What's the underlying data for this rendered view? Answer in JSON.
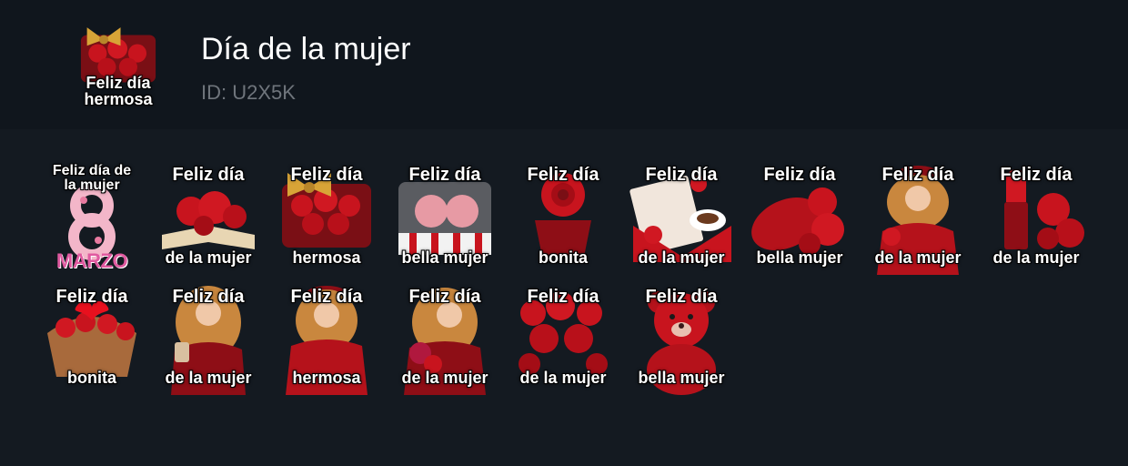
{
  "pack": {
    "title": "Día de la mujer",
    "id_label": "ID: U2X5K",
    "thumbnail": {
      "icon": "gift-strawberries-icon",
      "line1": "Feliz día",
      "line2": "hermosa"
    }
  },
  "colors": {
    "header_bg": "#10161d",
    "page_bg": "#141a21",
    "title": "#ffffff",
    "muted": "#6f757c",
    "accent_red": "#b5121b",
    "gold": "#d8a437"
  },
  "stickers": [
    {
      "icon": "number-eight-flowers-icon",
      "line1": "Feliz día de",
      "line2": "la mujer",
      "badge": "MARZO"
    },
    {
      "icon": "open-book-roses-icon",
      "line1": "Feliz día",
      "line2": "de la mujer"
    },
    {
      "icon": "gift-strawberries-icon",
      "line1": "Feliz día",
      "line2": "hermosa"
    },
    {
      "icon": "gift-box-roses-icon",
      "line1": "Feliz día",
      "line2": "bella mujer"
    },
    {
      "icon": "rose-cupcake-icon",
      "line1": "Feliz día",
      "line2": "bonita"
    },
    {
      "icon": "letter-coffee-icon",
      "line1": "Feliz día",
      "line2": "de la mujer"
    },
    {
      "icon": "beret-peonies-icon",
      "line1": "Feliz día",
      "line2": "bella mujer"
    },
    {
      "icon": "woman-red-beret-icon",
      "line1": "Feliz día",
      "line2": "de la mujer"
    },
    {
      "icon": "lipstick-roses-icon",
      "line1": "Feliz día",
      "line2": "de la mujer"
    },
    {
      "icon": "heart-rose-basket-icon",
      "line1": "Feliz día",
      "line2": "bonita"
    },
    {
      "icon": "woman-coffee-icon",
      "line1": "Feliz día",
      "line2": "de la mujer"
    },
    {
      "icon": "woman-red-coat-icon",
      "line1": "Feliz día",
      "line2": "hermosa"
    },
    {
      "icon": "woman-bouquet-icon",
      "line1": "Feliz día",
      "line2": "de la mujer"
    },
    {
      "icon": "rose-bouquet-icon",
      "line1": "Feliz día",
      "line2": "de la mujer"
    },
    {
      "icon": "teddy-bear-roses-icon",
      "line1": "Feliz día",
      "line2": "bella mujer"
    }
  ]
}
